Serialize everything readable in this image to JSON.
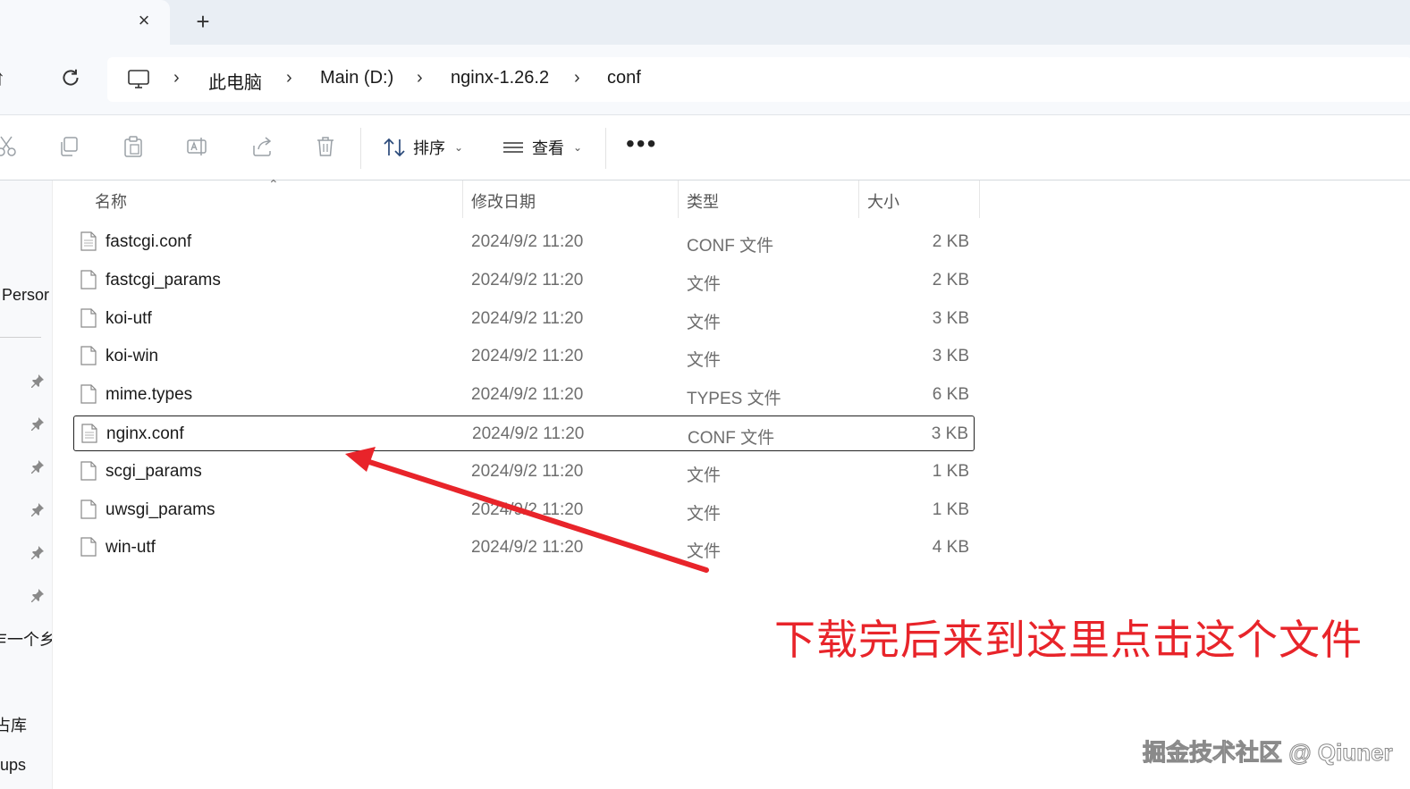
{
  "tabs": {
    "close_glyph": "×",
    "new_tab_glyph": "+"
  },
  "nav": {
    "up_glyph": "↑",
    "breadcrumbs": [
      "此电脑",
      "Main (D:)",
      "nginx-1.26.2",
      "conf"
    ],
    "separator": "›"
  },
  "toolbar": {
    "sort_label": "排序",
    "view_label": "查看",
    "more_label": "•••",
    "icons": [
      "cut-icon",
      "copy-icon",
      "paste-icon",
      "rename-icon",
      "share-icon",
      "delete-icon"
    ]
  },
  "sidebar": {
    "items": [
      "Persor",
      "乍一个乡",
      "占库",
      "ups"
    ]
  },
  "columns": {
    "name": "名称",
    "date": "修改日期",
    "type": "类型",
    "size": "大小"
  },
  "files": [
    {
      "name": "fastcgi.conf",
      "date": "2024/9/2 11:20",
      "type": "CONF 文件",
      "size": "2 KB",
      "icon": "conf-file-icon"
    },
    {
      "name": "fastcgi_params",
      "date": "2024/9/2 11:20",
      "type": "文件",
      "size": "2 KB",
      "icon": "file-icon"
    },
    {
      "name": "koi-utf",
      "date": "2024/9/2 11:20",
      "type": "文件",
      "size": "3 KB",
      "icon": "file-icon"
    },
    {
      "name": "koi-win",
      "date": "2024/9/2 11:20",
      "type": "文件",
      "size": "3 KB",
      "icon": "file-icon"
    },
    {
      "name": "mime.types",
      "date": "2024/9/2 11:20",
      "type": "TYPES 文件",
      "size": "6 KB",
      "icon": "file-icon"
    },
    {
      "name": "nginx.conf",
      "date": "2024/9/2 11:20",
      "type": "CONF 文件",
      "size": "3 KB",
      "icon": "conf-file-icon",
      "selected": true
    },
    {
      "name": "scgi_params",
      "date": "2024/9/2 11:20",
      "type": "文件",
      "size": "1 KB",
      "icon": "file-icon"
    },
    {
      "name": "uwsgi_params",
      "date": "2024/9/2 11:20",
      "type": "文件",
      "size": "1 KB",
      "icon": "file-icon"
    },
    {
      "name": "win-utf",
      "date": "2024/9/2 11:20",
      "type": "文件",
      "size": "4 KB",
      "icon": "file-icon"
    }
  ],
  "annotation": {
    "text": "下载完后来到这里点击这个文件",
    "color": "#e8242a"
  },
  "watermark": "掘金技术社区 @ Qiuner",
  "colors": {
    "accent": "#e8242a",
    "selection_border": "#222222",
    "chrome_bg": "#e9eef4"
  }
}
